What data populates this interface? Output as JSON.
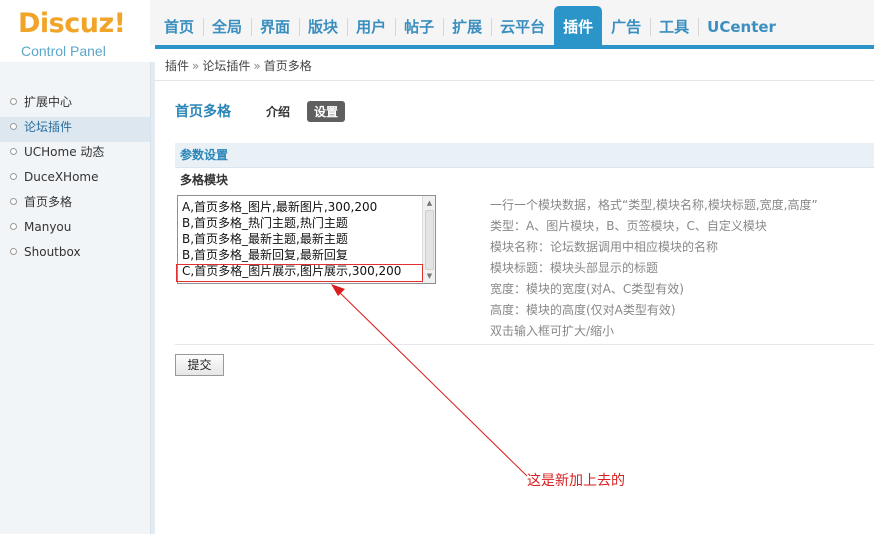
{
  "logo": {
    "title": "Discuz!",
    "subtitle": "Control Panel"
  },
  "nav": {
    "items": [
      {
        "label": "首页"
      },
      {
        "label": "全局"
      },
      {
        "label": "界面"
      },
      {
        "label": "版块"
      },
      {
        "label": "用户"
      },
      {
        "label": "帖子"
      },
      {
        "label": "扩展"
      },
      {
        "label": "云平台"
      },
      {
        "label": "插件"
      },
      {
        "label": "广告"
      },
      {
        "label": "工具"
      },
      {
        "label": "UCenter"
      }
    ],
    "active": "插件"
  },
  "breadcrumb": {
    "items": [
      "插件",
      "论坛插件",
      "首页多格"
    ],
    "separator": "»"
  },
  "sidebar": {
    "items": [
      {
        "label": "扩展中心"
      },
      {
        "label": "论坛插件"
      },
      {
        "label": "UCHome 动态"
      },
      {
        "label": "DuceXHome"
      },
      {
        "label": "首页多格"
      },
      {
        "label": "Manyou"
      },
      {
        "label": "Shoutbox"
      }
    ],
    "active": "论坛插件"
  },
  "main": {
    "title": "首页多格",
    "tabs": [
      {
        "label": "介绍"
      },
      {
        "label": "设置"
      }
    ],
    "active_tab": "设置",
    "section_title": "参数设置",
    "field_label": "多格模块",
    "textarea_lines": [
      "A,首页多格_图片,最新图片,300,200",
      "B,首页多格_热门主题,热门主题",
      "B,首页多格_最新主题,最新主题",
      "B,首页多格_最新回复,最新回复",
      "C,首页多格_图片展示,图片展示,300,200"
    ],
    "help_lines": [
      "一行一个模块数据，格式“类型,模块名称,模块标题,宽度,高度”",
      "类型：A、图片模块，B、页签模块，C、自定义模块",
      "模块名称：论坛数据调用中相应模块的名称",
      "模块标题：模块头部显示的标题",
      "宽度：模块的宽度(对A、C类型有效)",
      "高度：模块的高度(仅对A类型有效)",
      "双击输入框可扩大/缩小"
    ],
    "submit_label": "提交"
  },
  "annotation": {
    "text": "这是新加上去的",
    "color": "#d81e1e"
  },
  "colors": {
    "accent": "#2b95c9",
    "logo": "#f0a42a",
    "highlight": "#e03030"
  }
}
